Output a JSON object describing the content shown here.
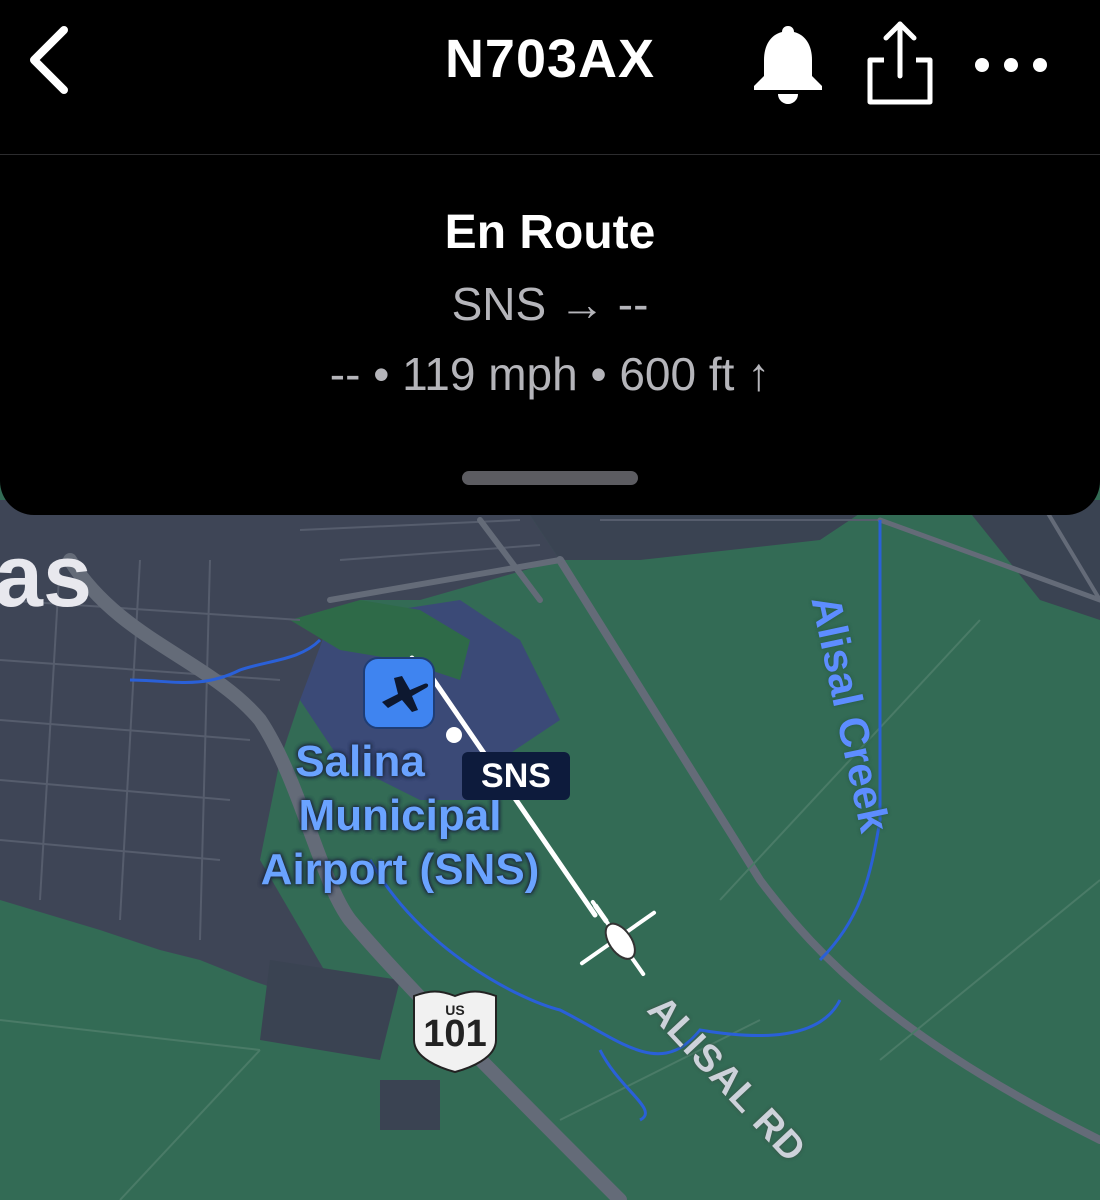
{
  "header": {
    "title": "N703AX"
  },
  "flight": {
    "status": "En Route",
    "route": "SNS → --",
    "stats": "-- • 119 mph • 600 ft ↑"
  },
  "map": {
    "city_label": "as",
    "airport_name_line1": "Salina",
    "airport_name_line2": "Municipal",
    "airport_name_line3": "Airport (SNS)",
    "airport_code_tag": "SNS",
    "highway_prefix": "US",
    "highway_number": "101",
    "road_label": "ALISAL RD",
    "creek_label": "Alisal Creek"
  },
  "colors": {
    "farmland": "#336b55",
    "urban": "#3e4556",
    "airport_area": "#3b4a77",
    "road": "#646b78",
    "water": "#2a60d8",
    "label_blue": "#6aa3ff"
  },
  "icons": [
    "back-chevron-icon",
    "bell-icon",
    "share-icon",
    "more-icon",
    "airport-icon",
    "aircraft-icon"
  ]
}
